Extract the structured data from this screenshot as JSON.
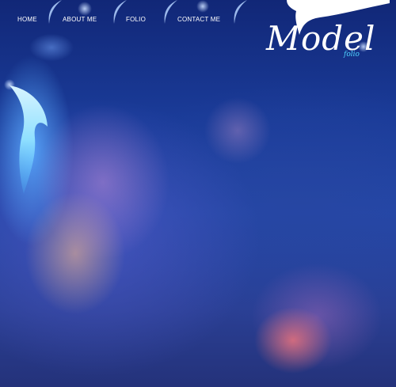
{
  "nav": {
    "items": [
      {
        "label": "HOME"
      },
      {
        "label": "ABOUT ME"
      },
      {
        "label": "FOLIO"
      },
      {
        "label": "CONTACT ME"
      }
    ]
  },
  "logo": {
    "main": "Model",
    "sub": "folio"
  },
  "colors": {
    "background": "#1a3b98",
    "nav_text": "#ffffff",
    "logo_accent": "#4fd6ff"
  }
}
